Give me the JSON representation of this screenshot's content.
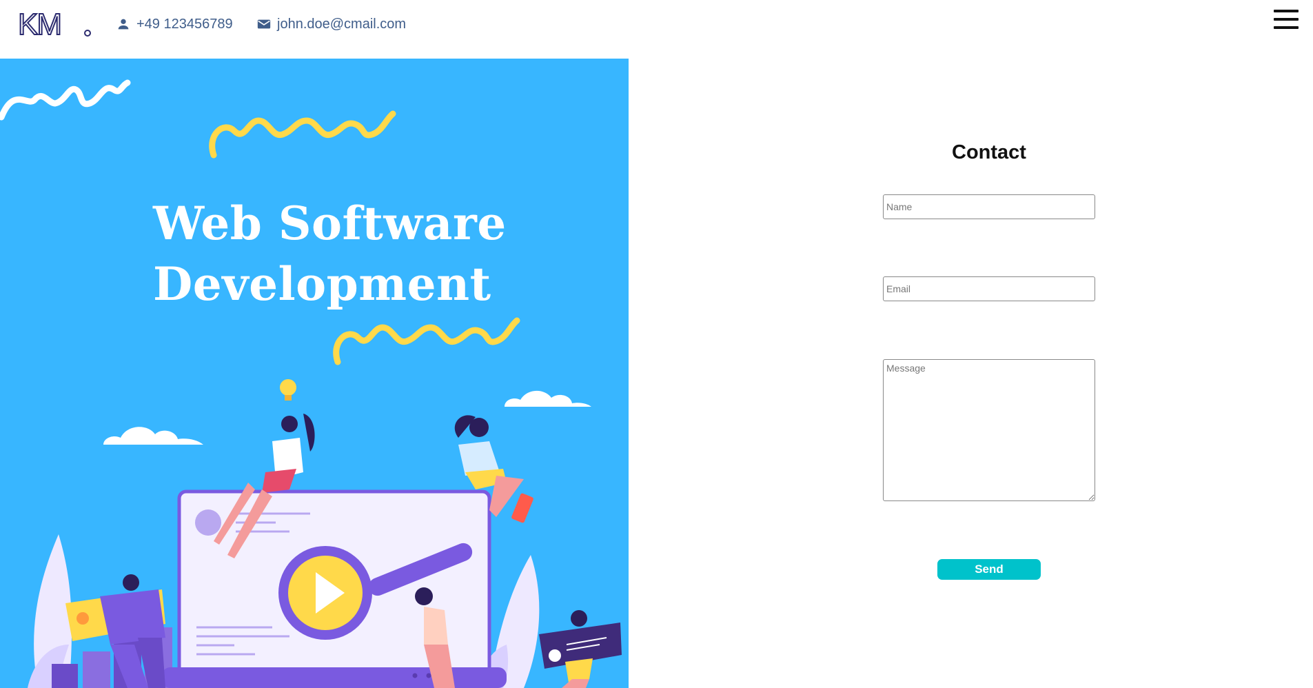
{
  "header": {
    "logo_text": "KM.",
    "phone": "+49 123456789",
    "email": "john.doe@cmail.com",
    "phone_icon": "person-icon",
    "email_icon": "mail-icon",
    "menu_icon": "hamburger-menu-icon"
  },
  "hero": {
    "title_line1": "Web Software",
    "title_line2": "Development",
    "background_color": "#38b6ff",
    "accent_color": "#ffd94a"
  },
  "contact": {
    "title": "Contact",
    "name_placeholder": "Name",
    "email_placeholder": "Email",
    "message_placeholder": "Message",
    "send_label": "Send",
    "button_color": "#00c2cb"
  }
}
